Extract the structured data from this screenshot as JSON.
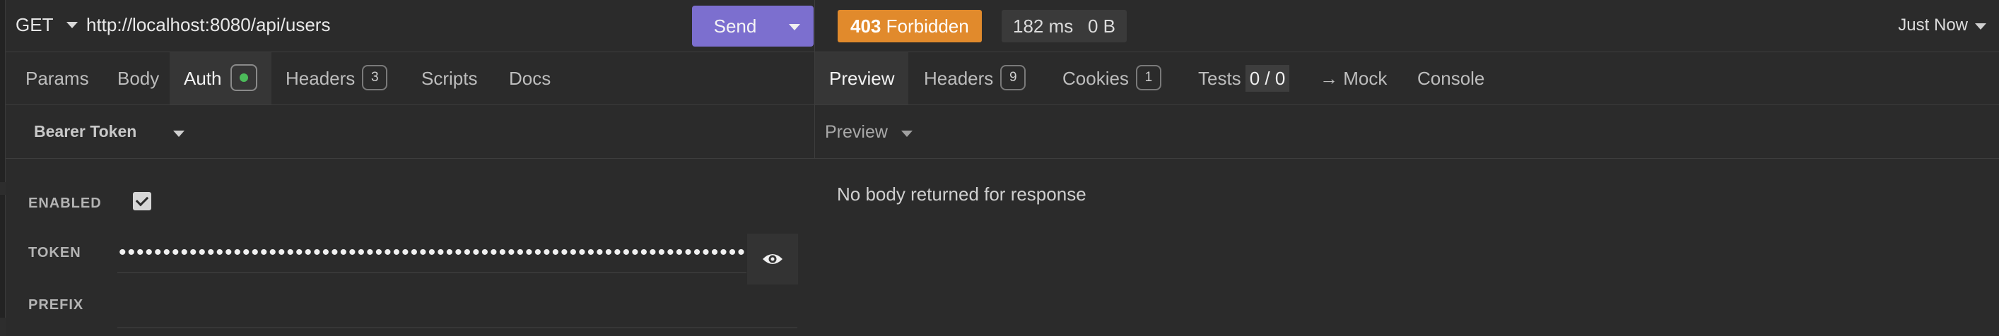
{
  "request": {
    "method": "GET",
    "url": "http://localhost:8080/api/users",
    "send_label": "Send"
  },
  "response": {
    "status_code": "403",
    "status_text": "Forbidden",
    "time": "182 ms",
    "size": "0 B",
    "history_label": "Just Now",
    "status_color": "#e18a2c"
  },
  "request_tabs": [
    {
      "label": "Params"
    },
    {
      "label": "Body"
    },
    {
      "label": "Auth",
      "active": true,
      "indicator": "green-dot"
    },
    {
      "label": "Headers",
      "count": "3"
    },
    {
      "label": "Scripts"
    },
    {
      "label": "Docs"
    }
  ],
  "response_tabs": [
    {
      "label": "Preview",
      "active": true
    },
    {
      "label": "Headers",
      "count": "9"
    },
    {
      "label": "Cookies",
      "count": "1"
    },
    {
      "label": "Tests",
      "value": "0 / 0"
    },
    {
      "label": "→ Mock"
    },
    {
      "label": "Console"
    }
  ],
  "auth": {
    "type_label": "Bearer Token",
    "enabled_label": "ENABLED",
    "enabled": true,
    "token_label": "TOKEN",
    "token_masked": "••••••••••••••••••••••••••••••••••••••••••••••••••••••••••••••••••••••••••••",
    "prefix_label": "PREFIX",
    "prefix_value": ""
  },
  "preview": {
    "mode_label": "Preview",
    "empty_message": "No body returned for response"
  },
  "colors": {
    "accent": "#7c6fcf",
    "background": "#2b2b2b",
    "auth_ok": "#4cbb5a"
  }
}
